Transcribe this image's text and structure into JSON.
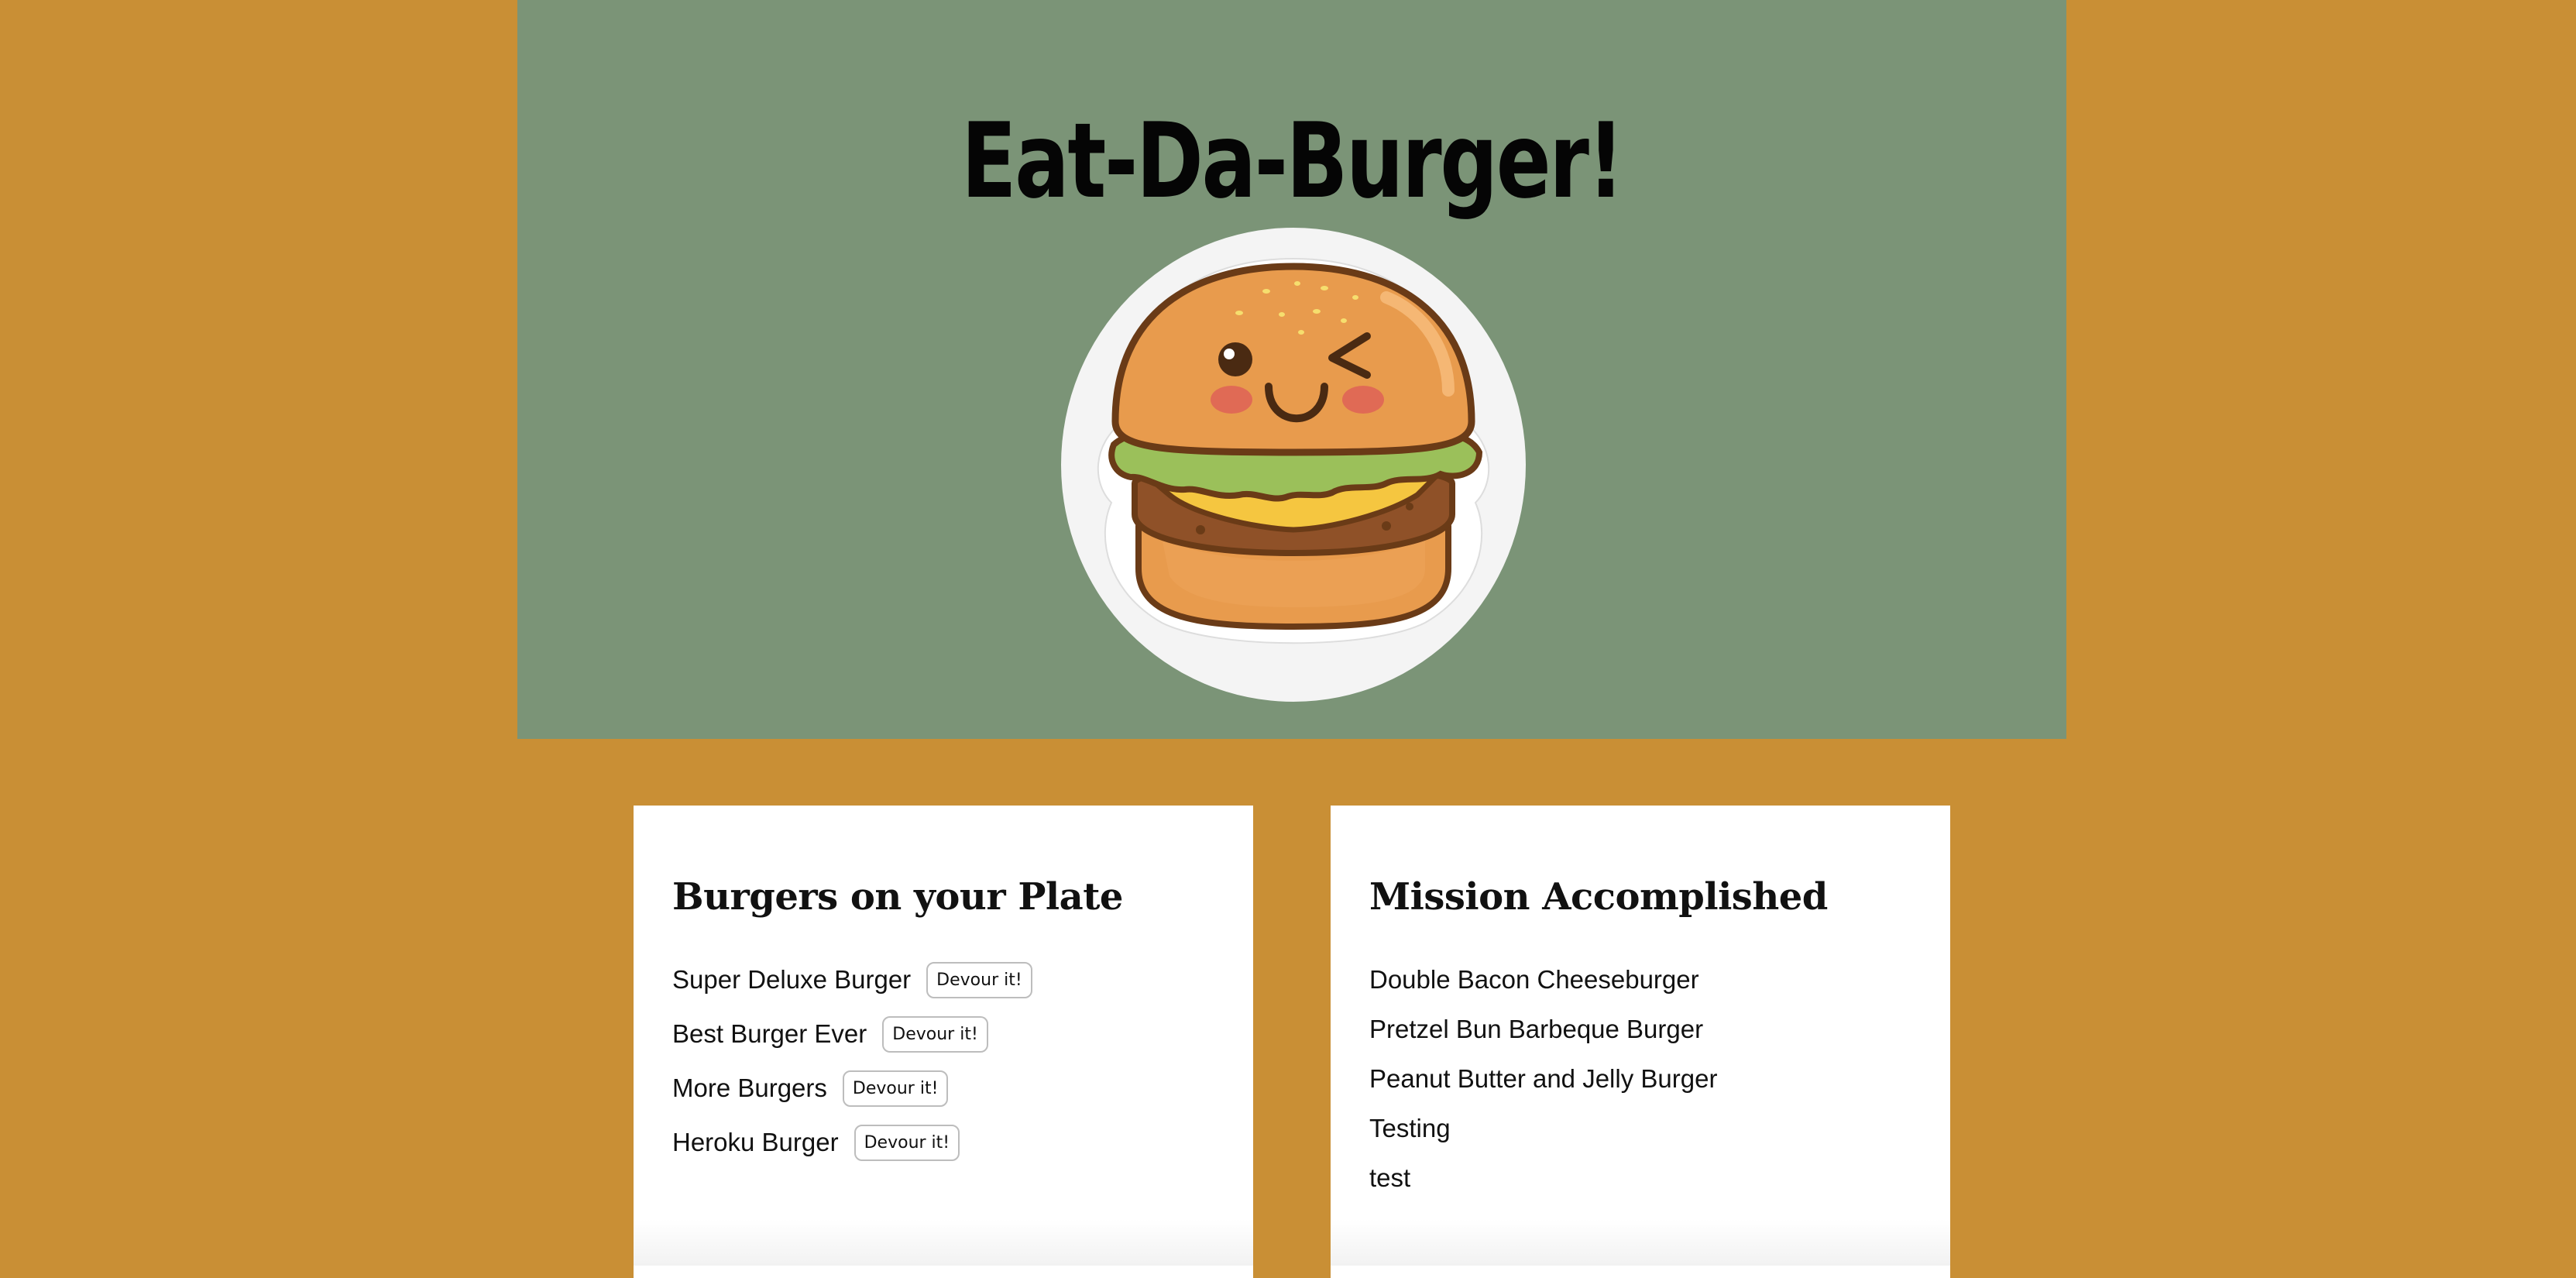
{
  "header": {
    "title": "Eat-Da-Burger!",
    "logo": "winking-burger-logo"
  },
  "plate": {
    "title": "Burgers on your Plate",
    "button_label": "Devour it!",
    "items": [
      {
        "name": "Super Deluxe Burger"
      },
      {
        "name": "Best Burger Ever"
      },
      {
        "name": "More Burgers"
      },
      {
        "name": "Heroku Burger"
      }
    ]
  },
  "devoured": {
    "title": "Mission Accomplished",
    "items": [
      {
        "name": "Double Bacon Cheeseburger"
      },
      {
        "name": "Pretzel Bun Barbeque Burger"
      },
      {
        "name": "Peanut Butter and Jelly Burger"
      },
      {
        "name": "Testing"
      },
      {
        "name": "test"
      }
    ]
  },
  "colors": {
    "page_background": "#c98f35",
    "hero_background": "#7b9477",
    "card_background": "#ffffff"
  }
}
